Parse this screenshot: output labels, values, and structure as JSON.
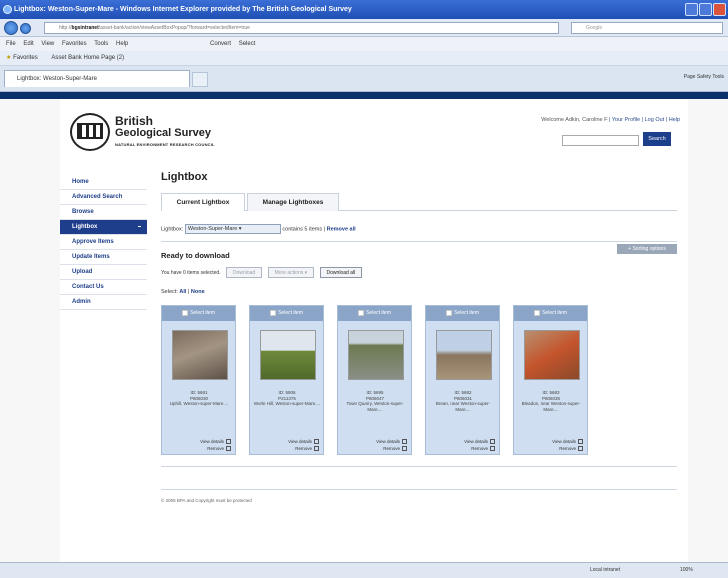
{
  "window": {
    "title": "Lightbox: Weston-Super-Mare - Windows Internet Explorer provided by The British Geological Survey"
  },
  "browser": {
    "address_prefix": "http://",
    "address_host": "bgsintranet",
    "address_rest": "/asset-bank/action/viewAssetBoxPopup/?forward=selectedItem=true",
    "search_placeholder": "Google",
    "menu": [
      "File",
      "Edit",
      "View",
      "Favorites",
      "Tools",
      "Help"
    ],
    "convert_label": "Convert",
    "select_label": "Select",
    "favorites_label": "Favorites",
    "fav_link": "Asset Bank Home Page (2)",
    "tab_label": "Lightbox: Weston-Super-Mare",
    "cmd_items": "Page  Safety  Tools",
    "status_zone": "Local intranet",
    "status_zoom": "100%"
  },
  "site": {
    "brand_line1": "British",
    "brand_line2": "Geological Survey",
    "brand_line3": "NATURAL ENVIRONMENT RESEARCH COUNCIL",
    "welcome": "Welcome Adkin, Caroline F",
    "your_profile": "Your Profile",
    "log_out": "Log Out",
    "help": "Help",
    "search_button": "Search"
  },
  "nav": [
    "Home",
    "Advanced Search",
    "Browse",
    "Lightbox",
    "Approve Items",
    "Update Items",
    "Upload",
    "Contact Us",
    "Admin"
  ],
  "main": {
    "title": "Lightbox",
    "tab_current": "Current Lightbox",
    "tab_manage": "Manage Lightboxes",
    "lightbox_label": "Lightbox:",
    "lightbox_value": "Weston-Super-Mare",
    "contains": "contains 5 items |",
    "remove_all": "Remove all",
    "sorting": "+ Sorting options",
    "ready": "Ready to download",
    "selected_text": "You have 0 items selected.",
    "download_btn": "Download",
    "more_actions": "More actions ▾",
    "download_all": "Download all",
    "select_label": "Select:",
    "select_all": "All",
    "select_none": "None",
    "footer_text": "© 2005 BPA and Copyright must be protected"
  },
  "cards": [
    {
      "head": "Select item",
      "id": "ID: 5681",
      "ref": "P806030",
      "place": "Uphill, Weston-super-Mare....",
      "view": "View details",
      "remove": "Remove",
      "colors": [
        "#7b6b5e",
        "#a39582",
        "#5e5148"
      ]
    },
    {
      "head": "Select item",
      "id": "ID: 5906",
      "ref": "P211375",
      "place": "Worle Hill, Weston-super-Mare....",
      "view": "View details",
      "remove": "Remove",
      "colors": [
        "#dfe6ee",
        "#6f8a3c",
        "#4f6a2a"
      ]
    },
    {
      "head": "Select item",
      "id": "ID: 5695",
      "ref": "P806047",
      "place": "Town Quarry, Weston-super-Mare....",
      "view": "View details",
      "remove": "Remove",
      "colors": [
        "#c8d2db",
        "#6c7a52",
        "#8a8f86"
      ]
    },
    {
      "head": "Select item",
      "id": "ID: 5682",
      "ref": "P806031",
      "place": "Brean, near Weston-super-Mare....",
      "view": "View details",
      "remove": "Remove",
      "colors": [
        "#bfd0e6",
        "#8a7660",
        "#a89478"
      ]
    },
    {
      "head": "Select item",
      "id": "ID: 5683",
      "ref": "P806035",
      "place": "Bleadon, near Weston-super-Mare....",
      "view": "View details",
      "remove": "Remove",
      "colors": [
        "#b89070",
        "#c4542c",
        "#8a4a2a"
      ]
    }
  ]
}
